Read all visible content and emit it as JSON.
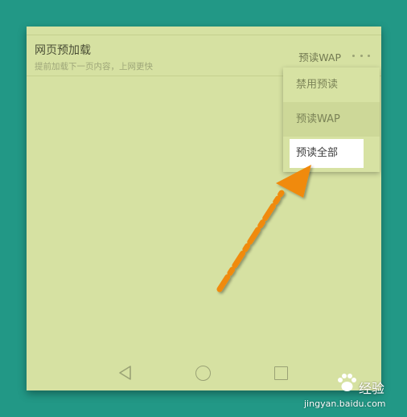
{
  "setting": {
    "title": "网页预加载",
    "subtitle": "提前加载下一页内容，上网更快",
    "current_value": "预读WAP",
    "more_icon": "more-horizontal-icon"
  },
  "menu": {
    "items": [
      {
        "label": "禁用预读"
      },
      {
        "label": "预读WAP"
      },
      {
        "label": "预读全部"
      }
    ],
    "highlighted_index": 2
  },
  "navbar": {
    "back_icon": "back-triangle-icon",
    "home_icon": "home-circle-icon",
    "recent_icon": "recent-square-icon"
  },
  "annotation": {
    "icon": "arrow-icon",
    "color": "#f08a0c"
  },
  "watermark": {
    "brand": "经验",
    "url": "jingyan.baidu.com"
  },
  "colors": {
    "background": "#229886",
    "screen": "#d6e1a2",
    "highlight": "#ffffff"
  }
}
